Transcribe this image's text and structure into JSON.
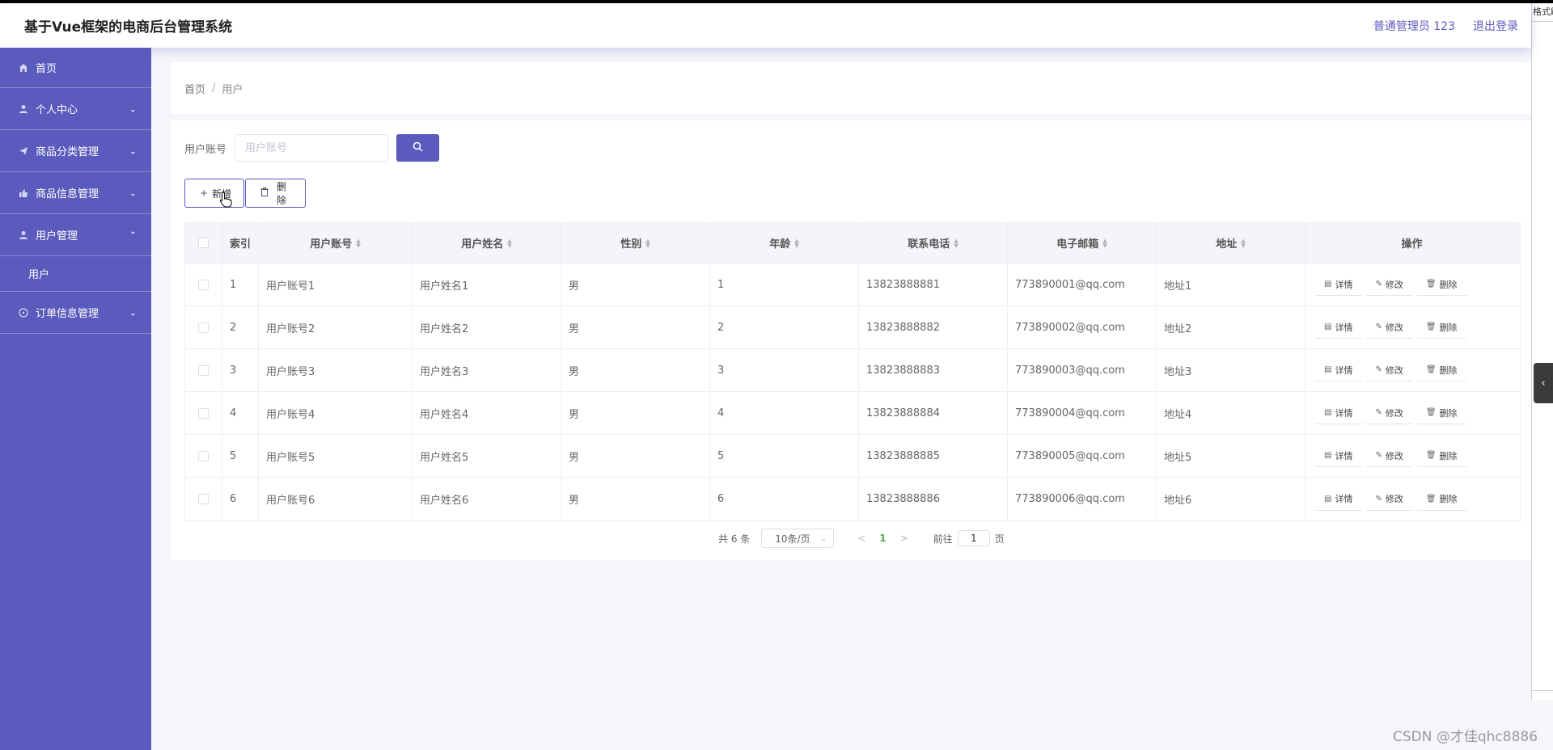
{
  "app": {
    "title": "基于Vue框架的电商后台管理系统",
    "user_label": "普通管理员 123",
    "logout_label": "退出登录"
  },
  "sidebar": {
    "items": [
      {
        "label": "首页",
        "icon": "home-icon"
      },
      {
        "label": "个人中心",
        "icon": "user-icon",
        "expandable": true
      },
      {
        "label": "商品分类管理",
        "icon": "send-icon",
        "expandable": true
      },
      {
        "label": "商品信息管理",
        "icon": "thumb-icon",
        "expandable": true
      },
      {
        "label": "用户管理",
        "icon": "user-icon",
        "expandable": true,
        "expanded": true
      },
      {
        "label": "订单信息管理",
        "icon": "orange-icon",
        "expandable": true
      }
    ],
    "sub_items": [
      {
        "label": "用户"
      }
    ]
  },
  "breadcrumb": {
    "home": "首页",
    "separator": "/",
    "current": "用户"
  },
  "search": {
    "label": "用户账号",
    "placeholder": "用户账号",
    "value": ""
  },
  "toolbar": {
    "add_label": "新增",
    "delete_label": "删除"
  },
  "table": {
    "columns": [
      "索引",
      "用户账号",
      "用户姓名",
      "性别",
      "年龄",
      "联系电话",
      "电子邮箱",
      "地址",
      "操作"
    ],
    "rows": [
      {
        "index": "1",
        "account": "用户账号1",
        "name": "用户姓名1",
        "sex": "男",
        "age": "1",
        "phone": "13823888881",
        "email": "773890001@qq.com",
        "address": "地址1"
      },
      {
        "index": "2",
        "account": "用户账号2",
        "name": "用户姓名2",
        "sex": "男",
        "age": "2",
        "phone": "13823888882",
        "email": "773890002@qq.com",
        "address": "地址2"
      },
      {
        "index": "3",
        "account": "用户账号3",
        "name": "用户姓名3",
        "sex": "男",
        "age": "3",
        "phone": "13823888883",
        "email": "773890003@qq.com",
        "address": "地址3"
      },
      {
        "index": "4",
        "account": "用户账号4",
        "name": "用户姓名4",
        "sex": "男",
        "age": "4",
        "phone": "13823888884",
        "email": "773890004@qq.com",
        "address": "地址4"
      },
      {
        "index": "5",
        "account": "用户账号5",
        "name": "用户姓名5",
        "sex": "男",
        "age": "5",
        "phone": "13823888885",
        "email": "773890005@qq.com",
        "address": "地址5"
      },
      {
        "index": "6",
        "account": "用户账号6",
        "name": "用户姓名6",
        "sex": "男",
        "age": "6",
        "phone": "13823888886",
        "email": "773890006@qq.com",
        "address": "地址6"
      }
    ],
    "actions": {
      "detail": "详情",
      "edit": "修改",
      "delete": "删除"
    }
  },
  "pagination": {
    "total_label": "共 6 条",
    "page_size": "10条/页",
    "current_page": "1",
    "goto_label": "前往",
    "goto_value": "1",
    "page_suffix": "页"
  },
  "right_panel": {
    "clipped_text": "格式刷"
  },
  "watermark": "CSDN @才佳qhc8886",
  "colors": {
    "accent": "#5b5bbd",
    "active_page": "#4caf50"
  }
}
